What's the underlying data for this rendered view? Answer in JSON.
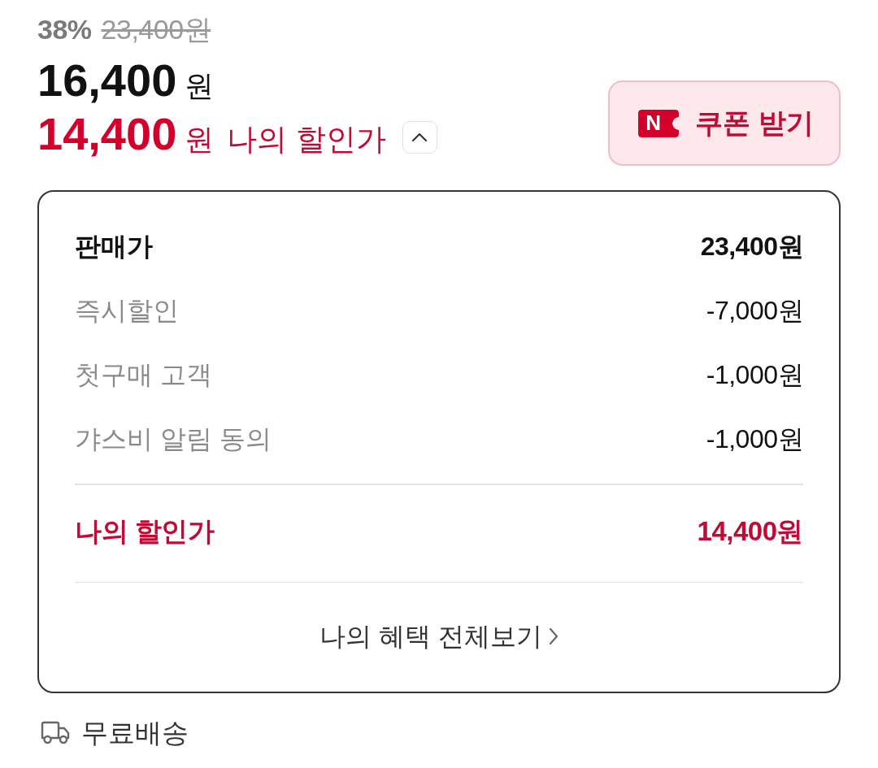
{
  "price": {
    "discount_rate": "38%",
    "original_price": "23,400원",
    "sale_price": {
      "amount": "16,400",
      "unit": "원"
    },
    "my_price": {
      "amount": "14,400",
      "unit": "원",
      "label": "나의 할인가",
      "expanded": true
    }
  },
  "coupon_button": {
    "logo_letter": "N",
    "label": "쿠폰 받기"
  },
  "breakdown": {
    "rows": [
      {
        "kind": "base",
        "label": "판매가",
        "value": "23,400원"
      },
      {
        "kind": "discount",
        "label": "즉시할인",
        "value": "-7,000원"
      },
      {
        "kind": "discount",
        "label": "첫구매 고객",
        "value": "-1,000원"
      },
      {
        "kind": "discount",
        "label": "갸스비 알림 동의",
        "value": "-1,000원"
      }
    ],
    "result": {
      "label": "나의 할인가",
      "value": "14,400원"
    },
    "link": {
      "label": "나의 혜택 전체보기"
    }
  },
  "shipping": {
    "label": "무료배송"
  }
}
